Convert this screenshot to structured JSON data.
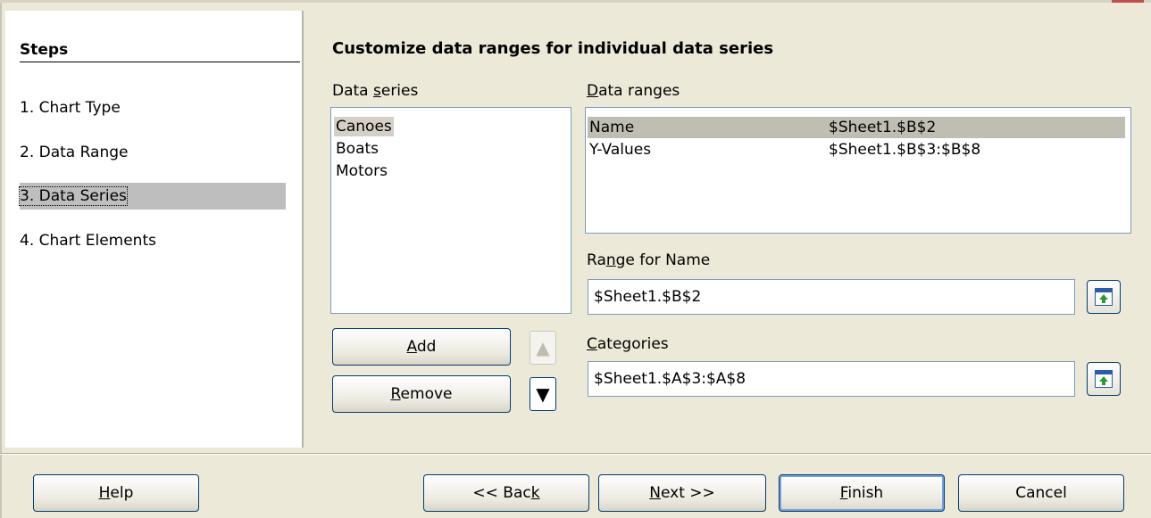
{
  "steps": {
    "title": "Steps",
    "items": [
      {
        "label": "1. Chart Type"
      },
      {
        "label": "2. Data Range"
      },
      {
        "label": "3. Data Series"
      },
      {
        "label": "4. Chart Elements"
      }
    ],
    "selected_index": 2
  },
  "main": {
    "heading": "Customize data ranges for individual data series",
    "data_series": {
      "label_prefix": "Data ",
      "label_accel": "s",
      "label_suffix": "eries",
      "items": [
        "Canoes",
        "Boats",
        "Motors"
      ],
      "selected": "Canoes"
    },
    "data_ranges": {
      "label_accel": "D",
      "label_suffix": "ata ranges",
      "rows": [
        {
          "role": "Name",
          "range": "$Sheet1.$B$2"
        },
        {
          "role": "Y-Values",
          "range": "$Sheet1.$B$3:$B$8"
        }
      ],
      "selected": "Name"
    },
    "range_for_name": {
      "label_prefix": "Ra",
      "label_accel": "n",
      "label_suffix": "ge for Name",
      "value": "$Sheet1.$B$2"
    },
    "categories": {
      "label_accel": "C",
      "label_suffix": "ategories",
      "value": "$Sheet1.$A$3:$A$8"
    },
    "add_button": {
      "accel": "A",
      "rest": "dd"
    },
    "remove_button": {
      "accel": "R",
      "rest": "emove"
    },
    "move_up_icon": "triangle-up",
    "move_down_icon": "triangle-down"
  },
  "footer": {
    "help": {
      "accel": "H",
      "rest": "elp"
    },
    "back": {
      "prefix": "<< Bac",
      "accel": "k"
    },
    "next": {
      "accel": "N",
      "rest": "ext >>"
    },
    "finish": {
      "accel": "F",
      "rest": "inish"
    },
    "cancel": "Cancel"
  }
}
